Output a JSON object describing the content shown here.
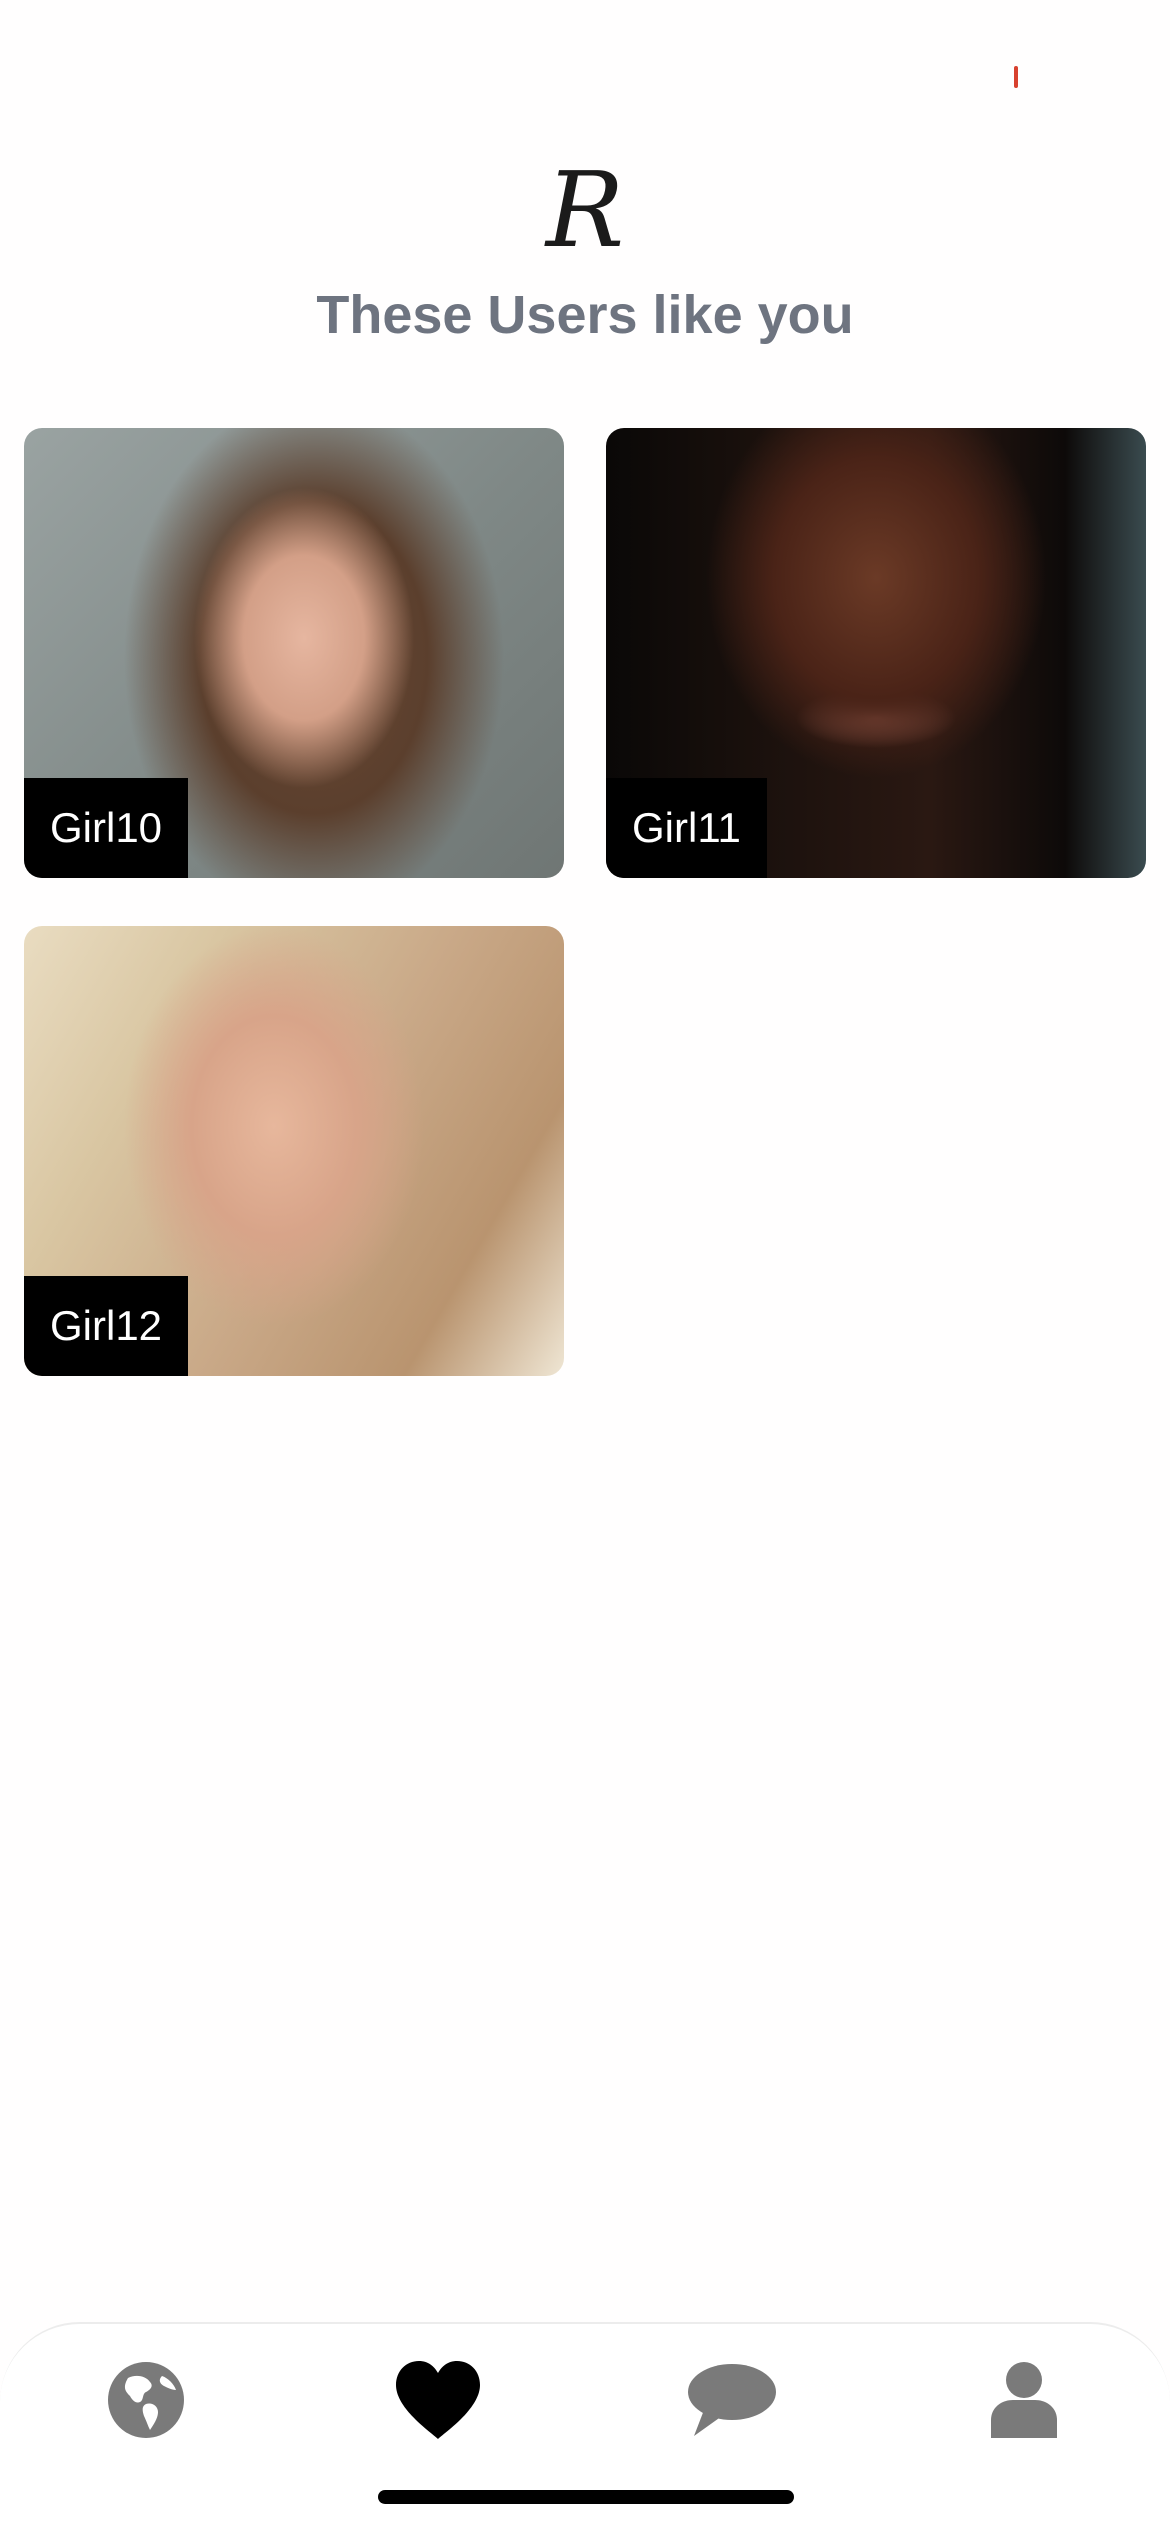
{
  "logo": {
    "text": "R"
  },
  "page_title": "These Users like you",
  "users": [
    {
      "name": "Girl10"
    },
    {
      "name": "Girl11"
    },
    {
      "name": "Girl12"
    }
  ],
  "tabbar": {
    "items": [
      {
        "id": "explore",
        "icon": "globe-icon",
        "active": false
      },
      {
        "id": "likes",
        "icon": "heart-icon",
        "active": true
      },
      {
        "id": "messages",
        "icon": "chat-bubble-icon",
        "active": false
      },
      {
        "id": "profile",
        "icon": "person-icon",
        "active": false
      }
    ],
    "active_color": "#000000",
    "inactive_color": "#7a7a7a"
  },
  "colors": {
    "title": "#6e7480",
    "name_tag_bg": "#000000",
    "name_tag_text": "#ffffff"
  }
}
